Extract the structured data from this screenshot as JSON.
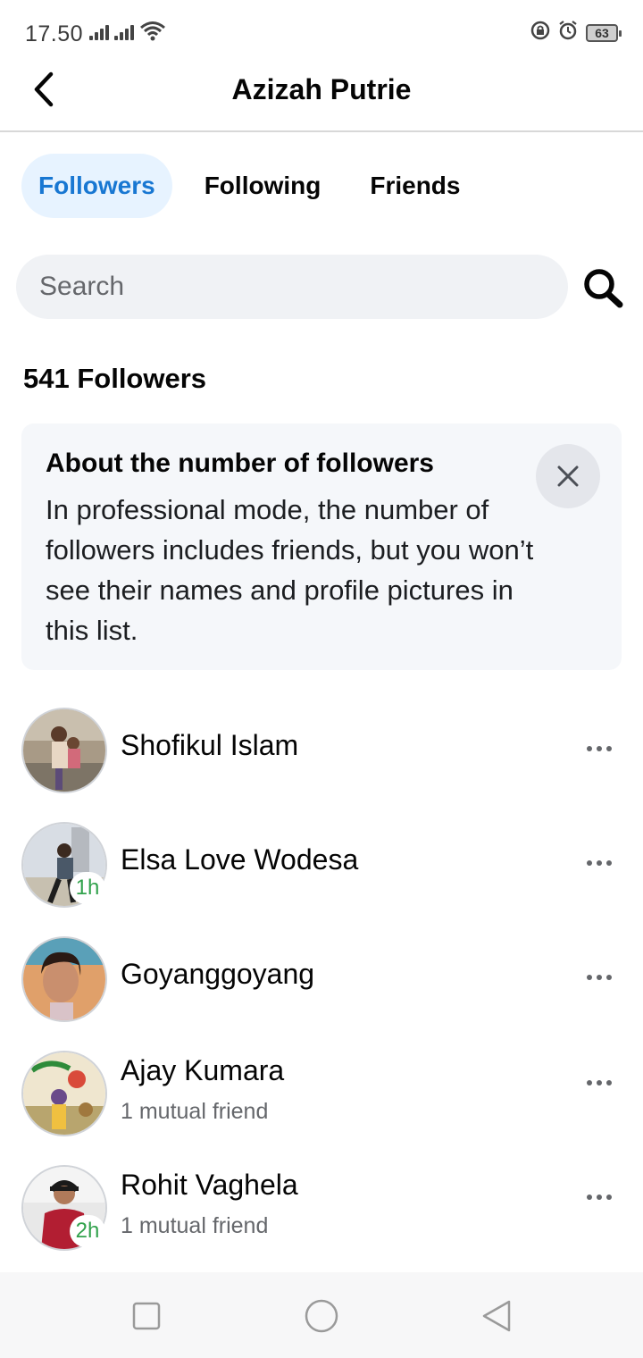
{
  "status_bar": {
    "time": "17.50",
    "battery": "63",
    "icons": [
      "signal-icon",
      "signal-icon",
      "wifi-icon",
      "lock-rotation-icon",
      "alarm-icon",
      "battery-icon"
    ]
  },
  "header": {
    "title": "Azizah Putrie",
    "back_icon": "chevron-left-icon"
  },
  "tabs": [
    {
      "label": "Followers",
      "active": true
    },
    {
      "label": "Following",
      "active": false
    },
    {
      "label": "Friends",
      "active": false
    }
  ],
  "search": {
    "placeholder": "Search",
    "icon": "search-icon"
  },
  "count_title": "541 Followers",
  "info_card": {
    "title": "About the number of followers",
    "body": "In professional mode, the number of followers includes friends, but you won’t see their names and profile pictures in this list.",
    "close_icon": "close-icon"
  },
  "followers": [
    {
      "name": "Shofikul Islam",
      "subtitle": "",
      "badge": ""
    },
    {
      "name": "Elsa Love Wodesa",
      "subtitle": "",
      "badge": "1h"
    },
    {
      "name": "Goyanggoyang",
      "subtitle": "",
      "badge": ""
    },
    {
      "name": "Ajay Kumara",
      "subtitle": "1 mutual friend",
      "badge": ""
    },
    {
      "name": "Rohit Vaghela",
      "subtitle": "1 mutual friend",
      "badge": "2h"
    }
  ],
  "navbar": {
    "icons": [
      "recent-apps-icon",
      "home-icon",
      "back-icon"
    ]
  },
  "colors": {
    "accent": "#1877d2",
    "tab_active_bg": "#e7f3ff",
    "active_badge": "#31a24c",
    "muted_text": "#65676b"
  }
}
